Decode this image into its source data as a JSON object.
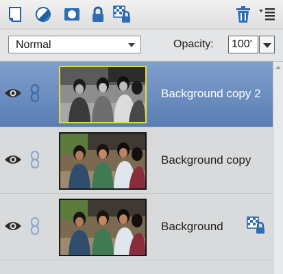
{
  "toolbar": {
    "buttons": [
      {
        "name": "new-layer-icon"
      },
      {
        "name": "adjustment-layer-icon"
      },
      {
        "name": "layer-mask-icon"
      },
      {
        "name": "lock-all-icon"
      },
      {
        "name": "lock-transparency-icon"
      }
    ],
    "delete_icon": "trash-icon",
    "menu_icon": "panel-menu-icon"
  },
  "controls": {
    "blend_mode": "Normal",
    "opacity_label": "Opacity:",
    "opacity_value": "100'"
  },
  "layers": [
    {
      "name": "Background copy 2",
      "selected": true,
      "style": "bw",
      "locked": false
    },
    {
      "name": "Background copy",
      "selected": false,
      "style": "color",
      "locked": false
    },
    {
      "name": "Background",
      "selected": false,
      "style": "color",
      "locked": true
    }
  ],
  "colors": {
    "selected_row": "#6a8cc0",
    "selected_thumb_border": "#e8dc3a",
    "icon_blue": "#2f6db5"
  }
}
